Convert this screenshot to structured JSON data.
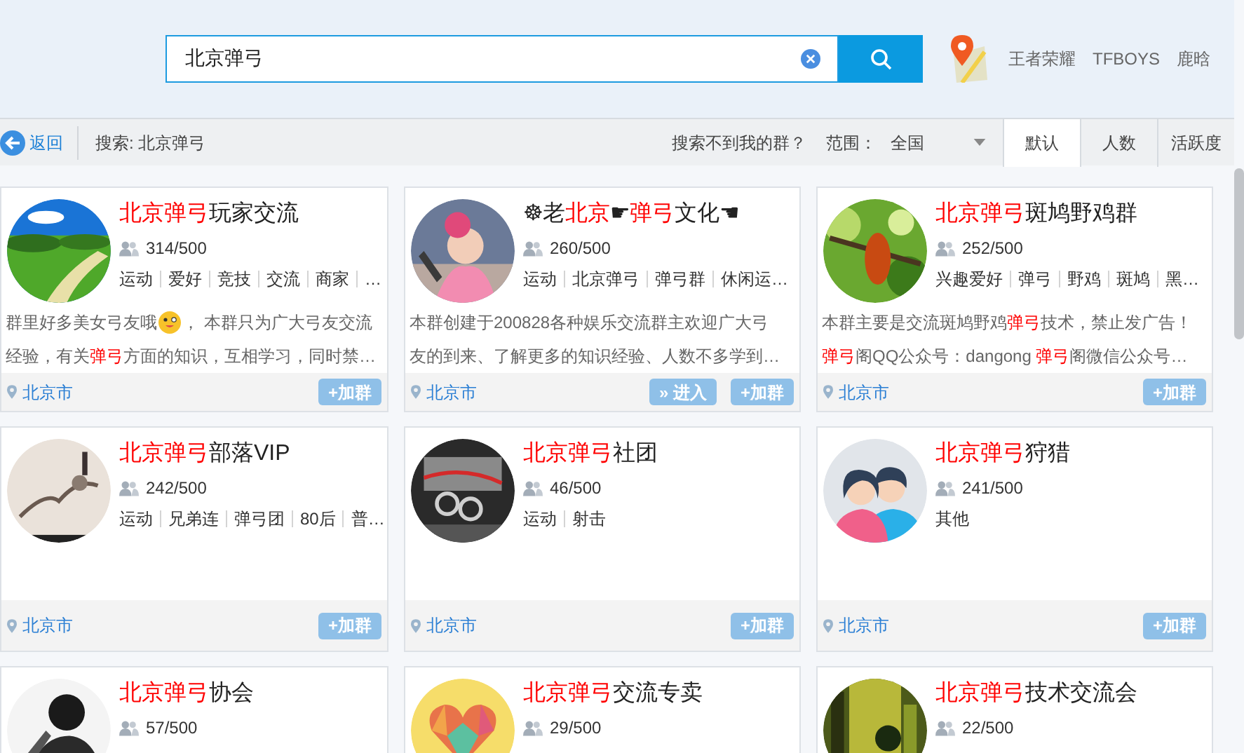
{
  "search": {
    "value": "北京弹弓"
  },
  "hot_words": [
    "王者荣耀",
    "TFBOYS",
    "鹿晗"
  ],
  "toolbar": {
    "back": "返回",
    "query": "搜索: 北京弹弓",
    "help_link": "搜索不到我的群？",
    "scope_label": "范围：",
    "scope_value": "全国"
  },
  "sort_tabs": [
    {
      "label": "默认",
      "selected": true
    },
    {
      "label": "人数",
      "selected": false
    },
    {
      "label": "活跃度",
      "selected": false
    }
  ],
  "groups": [
    {
      "title": [
        {
          "text": "北京弹弓",
          "highlight": true
        },
        {
          "text": "玩家交流",
          "highlight": false
        }
      ],
      "members": "314/500",
      "tags": [
        "运动",
        "爱好",
        "竞技",
        "交流",
        "商家",
        "…"
      ],
      "description": [
        [
          {
            "kind": "text",
            "text": "群里好多美女弓友哦"
          },
          {
            "kind": "emoji"
          },
          {
            "kind": "text",
            "text": "， 本群只为广大弓友交流"
          }
        ],
        [
          {
            "kind": "text",
            "text": "经验，有关"
          },
          {
            "kind": "highlight",
            "text": "弹弓"
          },
          {
            "kind": "text",
            "text": "方面的知识，互相学习，同时禁…"
          }
        ]
      ],
      "location": "北京市",
      "buttons": [
        "+加群"
      ]
    },
    {
      "title": [
        {
          "text": "☸老",
          "highlight": false
        },
        {
          "text": "北京",
          "highlight": true
        },
        {
          "text": "☛",
          "highlight": false
        },
        {
          "text": "弹弓",
          "highlight": true
        },
        {
          "text": "文化☚",
          "highlight": false
        }
      ],
      "members": "260/500",
      "tags": [
        "运动",
        "北京弹弓",
        "弹弓群",
        "休闲运…"
      ],
      "description": [
        [
          {
            "kind": "text",
            "text": "本群创建于200828各种娱乐交流群主欢迎广大弓"
          }
        ],
        [
          {
            "kind": "text",
            "text": "友的到来、了解更多的知识经验、人数不多学到…"
          }
        ]
      ],
      "location": "北京市",
      "buttons": [
        "» 进入",
        "+加群"
      ]
    },
    {
      "title": [
        {
          "text": "北京弹弓",
          "highlight": true
        },
        {
          "text": "斑鸠野鸡群",
          "highlight": false
        }
      ],
      "members": "252/500",
      "tags": [
        "兴趣爱好",
        "弹弓",
        "野鸡",
        "斑鸠",
        "黑…"
      ],
      "description": [
        [
          {
            "kind": "text",
            "text": "本群主要是交流斑鸠野鸡"
          },
          {
            "kind": "highlight",
            "text": "弹弓"
          },
          {
            "kind": "text",
            "text": "技术，禁止发广告！"
          }
        ],
        [
          {
            "kind": "highlight",
            "text": "弹弓"
          },
          {
            "kind": "text",
            "text": "阁QQ公众号：dangong "
          },
          {
            "kind": "highlight",
            "text": "弹弓"
          },
          {
            "kind": "text",
            "text": "阁微信公众号…"
          }
        ]
      ],
      "location": "北京市",
      "buttons": [
        "+加群"
      ]
    },
    {
      "title": [
        {
          "text": "北京弹弓",
          "highlight": true
        },
        {
          "text": "部落VIP",
          "highlight": false
        }
      ],
      "members": "242/500",
      "tags": [
        "运动",
        "兄弟连",
        "弹弓团",
        "80后",
        "普…"
      ],
      "location": "北京市",
      "buttons": [
        "+加群"
      ]
    },
    {
      "title": [
        {
          "text": "北京弹弓",
          "highlight": true
        },
        {
          "text": "社团",
          "highlight": false
        }
      ],
      "members": "46/500",
      "tags": [
        "运动",
        "射击"
      ],
      "location": "北京市",
      "buttons": [
        "+加群"
      ]
    },
    {
      "title": [
        {
          "text": "北京弹弓",
          "highlight": true
        },
        {
          "text": "狩猎",
          "highlight": false
        }
      ],
      "members": "241/500",
      "tags": [
        "其他"
      ],
      "location": "北京市",
      "buttons": [
        "+加群"
      ]
    },
    {
      "title": [
        {
          "text": "北京弹弓",
          "highlight": true
        },
        {
          "text": "协会",
          "highlight": false
        }
      ],
      "members": "57/500"
    },
    {
      "title": [
        {
          "text": "北京弹弓",
          "highlight": true
        },
        {
          "text": "交流专卖",
          "highlight": false
        }
      ],
      "members": "29/500"
    },
    {
      "title": [
        {
          "text": "北京弹弓",
          "highlight": true
        },
        {
          "text": "技术交流会",
          "highlight": false
        }
      ],
      "members": "22/500"
    }
  ]
}
